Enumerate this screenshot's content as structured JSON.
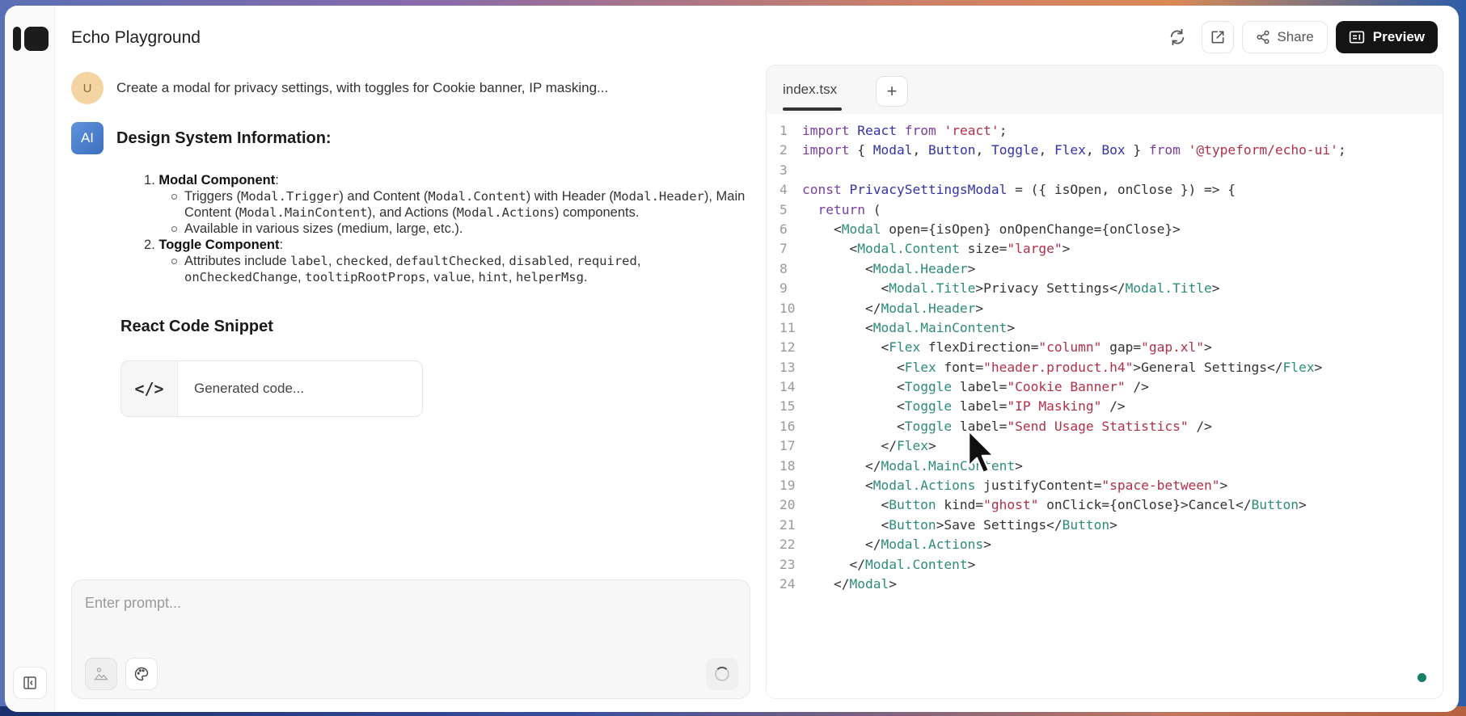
{
  "app": {
    "title": "Echo Playground"
  },
  "toolbar": {
    "refresh_icon": "refresh-icon",
    "open_external_icon": "external-link-icon",
    "share_label": "Share",
    "preview_label": "Preview"
  },
  "chat": {
    "user_avatar": "U",
    "user_message": "Create a modal for privacy settings, with toggles for Cookie banner, IP masking...",
    "ai_avatar": "AI",
    "ai_heading": "Design System Information:",
    "items": [
      {
        "number": "1.",
        "title": "Modal Component",
        "bullets": [
          {
            "parts": [
              {
                "t": "Triggers ("
              },
              {
                "c": "Modal.Trigger"
              },
              {
                "t": ") and Content ("
              },
              {
                "c": "Modal.Content"
              },
              {
                "t": ") with Header ("
              },
              {
                "c": "Modal.Header"
              },
              {
                "t": "), Main Content ("
              },
              {
                "c": "Modal.MainContent"
              },
              {
                "t": "), and Actions ("
              },
              {
                "c": "Modal.Actions"
              },
              {
                "t": ") components."
              }
            ]
          },
          {
            "parts": [
              {
                "t": "Available in various sizes (medium, large, etc.)."
              }
            ]
          }
        ]
      },
      {
        "number": "2.",
        "title": "Toggle Component",
        "bullets": [
          {
            "parts": [
              {
                "t": "Attributes include "
              },
              {
                "c": "label"
              },
              {
                "t": ", "
              },
              {
                "c": "checked"
              },
              {
                "t": ", "
              },
              {
                "c": "defaultChecked"
              },
              {
                "t": ", "
              },
              {
                "c": "disabled"
              },
              {
                "t": ", "
              },
              {
                "c": "required"
              },
              {
                "t": ", "
              },
              {
                "c": "onCheckedChange"
              },
              {
                "t": ", "
              },
              {
                "c": "tooltipRootProps"
              },
              {
                "t": ", "
              },
              {
                "c": "value"
              },
              {
                "t": ", "
              },
              {
                "c": "hint"
              },
              {
                "t": ", "
              },
              {
                "c": "helperMsg"
              },
              {
                "t": "."
              }
            ]
          }
        ]
      }
    ],
    "snippet_heading": "React Code Snippet",
    "code_card_icon": "</>",
    "code_card_label": "Generated code..."
  },
  "prompt": {
    "placeholder": "Enter prompt...",
    "value": ""
  },
  "editor": {
    "active_tab": "index.tsx",
    "add_tab_label": "+",
    "status_color": "#14806a",
    "lines": [
      [
        {
          "k": "kw",
          "v": "import "
        },
        {
          "k": "id",
          "v": "React "
        },
        {
          "k": "kw",
          "v": "from "
        },
        {
          "k": "str",
          "v": "'react'"
        },
        {
          "k": "",
          "v": ";"
        }
      ],
      [
        {
          "k": "kw",
          "v": "import "
        },
        {
          "k": "",
          "v": "{ "
        },
        {
          "k": "id",
          "v": "Modal"
        },
        {
          "k": "",
          "v": ", "
        },
        {
          "k": "id",
          "v": "Button"
        },
        {
          "k": "",
          "v": ", "
        },
        {
          "k": "id",
          "v": "Toggle"
        },
        {
          "k": "",
          "v": ", "
        },
        {
          "k": "id",
          "v": "Flex"
        },
        {
          "k": "",
          "v": ", "
        },
        {
          "k": "id",
          "v": "Box"
        },
        {
          "k": "",
          "v": " } "
        },
        {
          "k": "kw",
          "v": "from "
        },
        {
          "k": "str",
          "v": "'@typeform/echo-ui'"
        },
        {
          "k": "",
          "v": ";"
        }
      ],
      [],
      [
        {
          "k": "kw",
          "v": "const "
        },
        {
          "k": "id",
          "v": "PrivacySettingsModal"
        },
        {
          "k": "",
          "v": " = ({ isOpen, onClose }) => {"
        }
      ],
      [
        {
          "k": "",
          "v": "  "
        },
        {
          "k": "kw",
          "v": "return"
        },
        {
          "k": "",
          "v": " ("
        }
      ],
      [
        {
          "k": "",
          "v": "    <"
        },
        {
          "k": "tag",
          "v": "Modal"
        },
        {
          "k": "",
          "v": " open={isOpen} onOpenChange={onClose}>"
        }
      ],
      [
        {
          "k": "",
          "v": "      <"
        },
        {
          "k": "tag",
          "v": "Modal.Content"
        },
        {
          "k": "",
          "v": " size="
        },
        {
          "k": "str",
          "v": "\"large\""
        },
        {
          "k": "",
          "v": ">"
        }
      ],
      [
        {
          "k": "",
          "v": "        <"
        },
        {
          "k": "tag",
          "v": "Modal.Header"
        },
        {
          "k": "",
          "v": ">"
        }
      ],
      [
        {
          "k": "",
          "v": "          <"
        },
        {
          "k": "tag",
          "v": "Modal.Title"
        },
        {
          "k": "",
          "v": ">Privacy Settings</"
        },
        {
          "k": "tag",
          "v": "Modal.Title"
        },
        {
          "k": "",
          "v": ">"
        }
      ],
      [
        {
          "k": "",
          "v": "        </"
        },
        {
          "k": "tag",
          "v": "Modal.Header"
        },
        {
          "k": "",
          "v": ">"
        }
      ],
      [
        {
          "k": "",
          "v": "        <"
        },
        {
          "k": "tag",
          "v": "Modal.MainContent"
        },
        {
          "k": "",
          "v": ">"
        }
      ],
      [
        {
          "k": "",
          "v": "          <"
        },
        {
          "k": "tag",
          "v": "Flex"
        },
        {
          "k": "",
          "v": " flexDirection="
        },
        {
          "k": "str",
          "v": "\"column\""
        },
        {
          "k": "",
          "v": " gap="
        },
        {
          "k": "str",
          "v": "\"gap.xl\""
        },
        {
          "k": "",
          "v": ">"
        }
      ],
      [
        {
          "k": "",
          "v": "            <"
        },
        {
          "k": "tag",
          "v": "Flex"
        },
        {
          "k": "",
          "v": " font="
        },
        {
          "k": "str",
          "v": "\"header.product.h4\""
        },
        {
          "k": "",
          "v": ">General Settings</"
        },
        {
          "k": "tag",
          "v": "Flex"
        },
        {
          "k": "",
          "v": ">"
        }
      ],
      [
        {
          "k": "",
          "v": "            <"
        },
        {
          "k": "tag",
          "v": "Toggle"
        },
        {
          "k": "",
          "v": " label="
        },
        {
          "k": "str",
          "v": "\"Cookie Banner\""
        },
        {
          "k": "",
          "v": " />"
        }
      ],
      [
        {
          "k": "",
          "v": "            <"
        },
        {
          "k": "tag",
          "v": "Toggle"
        },
        {
          "k": "",
          "v": " label="
        },
        {
          "k": "str",
          "v": "\"IP Masking\""
        },
        {
          "k": "",
          "v": " />"
        }
      ],
      [
        {
          "k": "",
          "v": "            <"
        },
        {
          "k": "tag",
          "v": "Toggle"
        },
        {
          "k": "",
          "v": " label="
        },
        {
          "k": "str",
          "v": "\"Send Usage Statistics\""
        },
        {
          "k": "",
          "v": " />"
        }
      ],
      [
        {
          "k": "",
          "v": "          </"
        },
        {
          "k": "tag",
          "v": "Flex"
        },
        {
          "k": "",
          "v": ">"
        }
      ],
      [
        {
          "k": "",
          "v": "        </"
        },
        {
          "k": "tag",
          "v": "Modal.MainContent"
        },
        {
          "k": "",
          "v": ">"
        }
      ],
      [
        {
          "k": "",
          "v": "        <"
        },
        {
          "k": "tag",
          "v": "Modal.Actions"
        },
        {
          "k": "",
          "v": " justifyContent="
        },
        {
          "k": "str",
          "v": "\"space-between\""
        },
        {
          "k": "",
          "v": ">"
        }
      ],
      [
        {
          "k": "",
          "v": "          <"
        },
        {
          "k": "tag",
          "v": "Button"
        },
        {
          "k": "",
          "v": " kind="
        },
        {
          "k": "str",
          "v": "\"ghost\""
        },
        {
          "k": "",
          "v": " onClick={onClose}>Cancel</"
        },
        {
          "k": "tag",
          "v": "Button"
        },
        {
          "k": "",
          "v": ">"
        }
      ],
      [
        {
          "k": "",
          "v": "          <"
        },
        {
          "k": "tag",
          "v": "Button"
        },
        {
          "k": "",
          "v": ">Save Settings</"
        },
        {
          "k": "tag",
          "v": "Button"
        },
        {
          "k": "",
          "v": ">"
        }
      ],
      [
        {
          "k": "",
          "v": "        </"
        },
        {
          "k": "tag",
          "v": "Modal.Actions"
        },
        {
          "k": "",
          "v": ">"
        }
      ],
      [
        {
          "k": "",
          "v": "      </"
        },
        {
          "k": "tag",
          "v": "Modal.Content"
        },
        {
          "k": "",
          "v": ">"
        }
      ],
      [
        {
          "k": "",
          "v": "    </"
        },
        {
          "k": "tag",
          "v": "Modal"
        },
        {
          "k": "",
          "v": ">"
        }
      ]
    ]
  }
}
